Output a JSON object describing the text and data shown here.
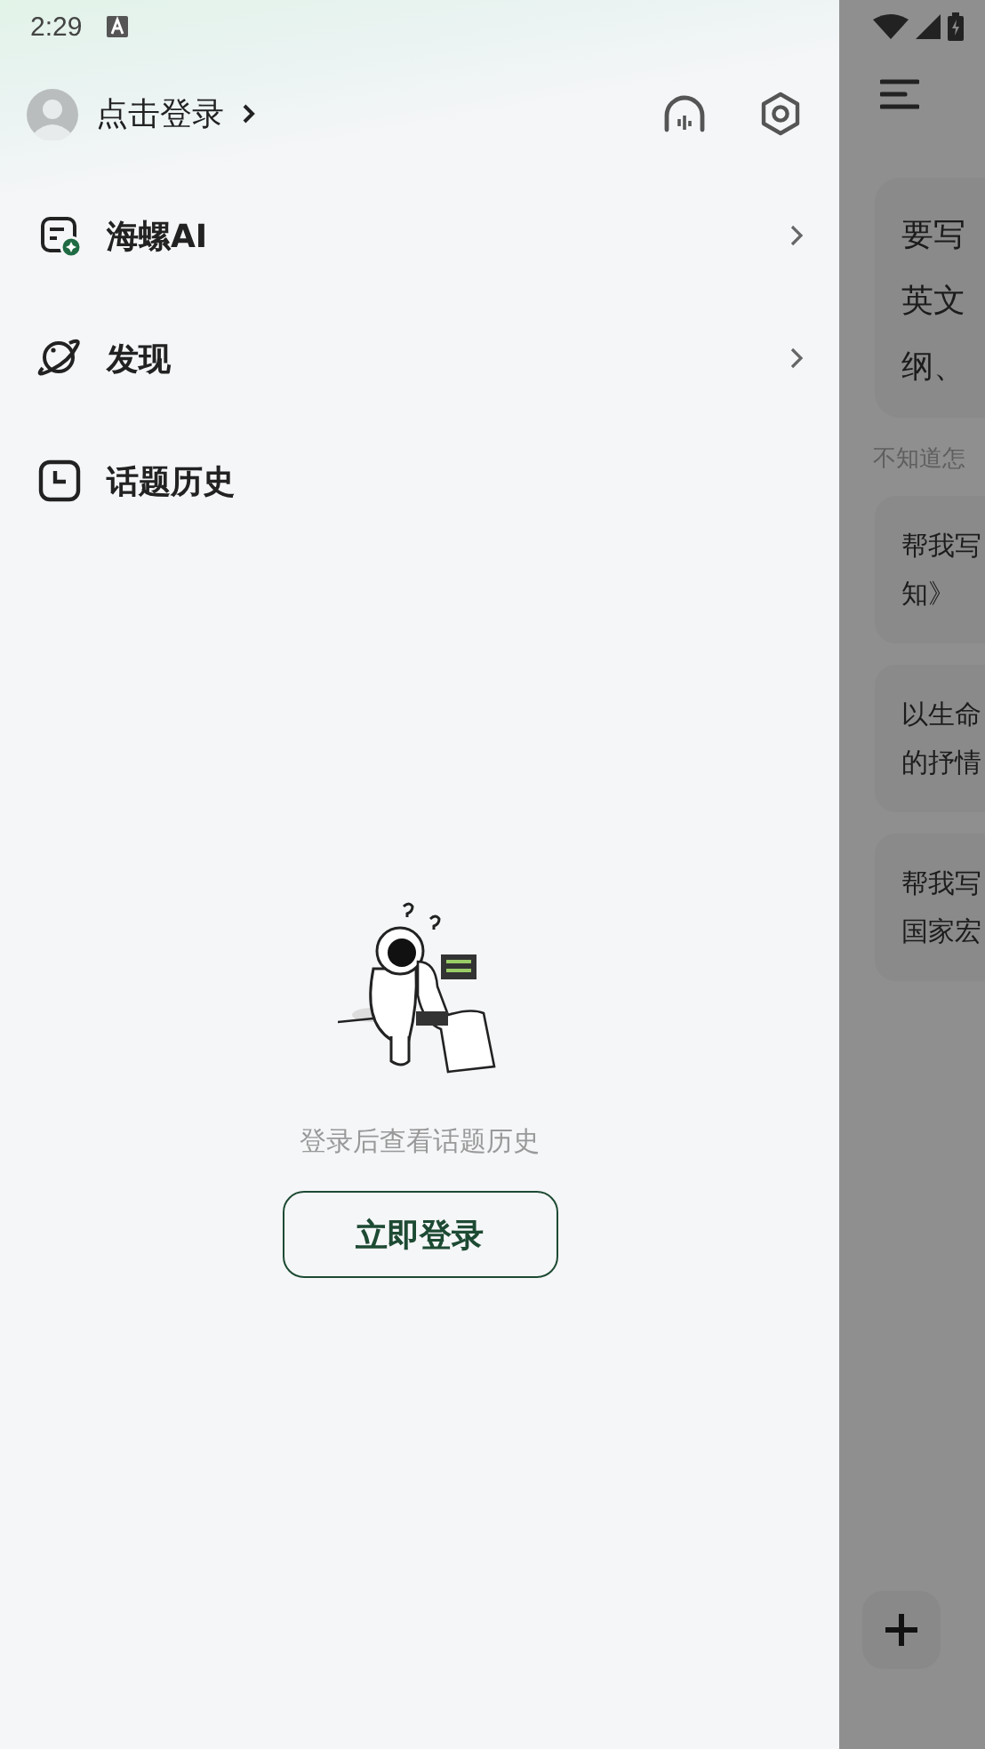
{
  "status_bar": {
    "time": "2:29"
  },
  "drawer": {
    "login_link": "点击登录",
    "menu": [
      {
        "label": "海螺AI",
        "kind": "ai",
        "has_arrow": true
      },
      {
        "label": "发现",
        "kind": "discover",
        "has_arrow": true
      },
      {
        "label": "话题历史",
        "kind": "history",
        "has_arrow": false
      }
    ],
    "empty_state": {
      "message": "登录后查看话题历史",
      "button": "立即登录"
    }
  },
  "main": {
    "prompt_lines": [
      "要写",
      "英文",
      "纲、"
    ],
    "hint": "不知道怎",
    "suggestions": [
      {
        "lines": [
          "帮我写",
          "知》"
        ]
      },
      {
        "lines": [
          "以生命",
          "的抒情"
        ]
      },
      {
        "lines": [
          "帮我写",
          "国家宏"
        ]
      }
    ]
  }
}
